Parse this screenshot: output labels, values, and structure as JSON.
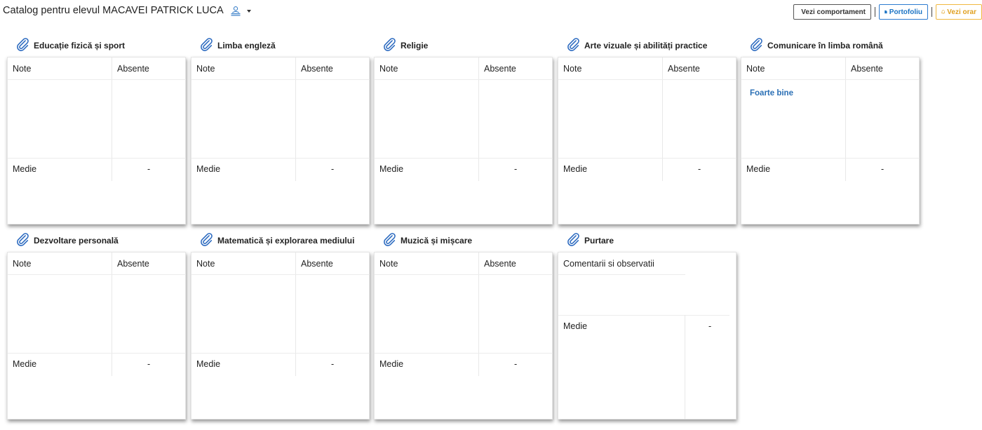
{
  "header": {
    "title": "Catalog pentru elevul MACAVEI PATRICK LUCA",
    "student_icon": "student-icon",
    "dropdown_icon": "caret-down-icon",
    "actions": {
      "comportament_label": "Vezi comportament",
      "portofoliu_label": "Portofoliu",
      "orar_label": "Vezi orar"
    }
  },
  "labels": {
    "note": "Note",
    "absente": "Absente",
    "medie": "Medie",
    "comentarii": "Comentarii si observatii"
  },
  "subjects": [
    {
      "name": "Educație fizică și sport",
      "grades": [],
      "medie": "-"
    },
    {
      "name": "Limba engleză",
      "grades": [],
      "medie": "-"
    },
    {
      "name": "Religie",
      "grades": [],
      "medie": "-"
    },
    {
      "name": "Arte vizuale și abilități practice",
      "grades": [],
      "medie": "-"
    },
    {
      "name": "Comunicare în limba română",
      "grades": [
        "Foarte bine"
      ],
      "medie": "-"
    },
    {
      "name": "Dezvoltare personală",
      "grades": [],
      "medie": "-"
    },
    {
      "name": "Matematică și explorarea mediului",
      "grades": [],
      "medie": "-"
    },
    {
      "name": "Muzică și mișcare",
      "grades": [],
      "medie": "-"
    }
  ],
  "purtare": {
    "name": "Purtare",
    "medie": "-"
  },
  "colors": {
    "link_blue": "#2a6fb5",
    "portofoliu_blue": "#1a73c4",
    "orar_orange": "#e0a020",
    "clip_blue": "#2d6bc0"
  }
}
